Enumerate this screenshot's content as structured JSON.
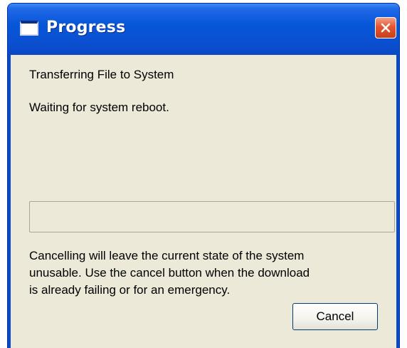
{
  "window": {
    "title": "Progress",
    "title_icon": "window-icon",
    "close_icon": "close-icon"
  },
  "content": {
    "status_line": "Transferring File to System",
    "detail_line": "Waiting for system reboot.",
    "progress_value": 0,
    "warning_text": "Cancelling will leave the current state of the system\nunusable. Use the cancel button when the download\nis already failing or for an emergency."
  },
  "buttons": {
    "cancel_label": "Cancel"
  },
  "colors": {
    "titlebar": "#0a4fd0",
    "dialog_background": "#ece9d8",
    "close_button": "#e4552f",
    "progress_fill": "#2fb52f"
  }
}
